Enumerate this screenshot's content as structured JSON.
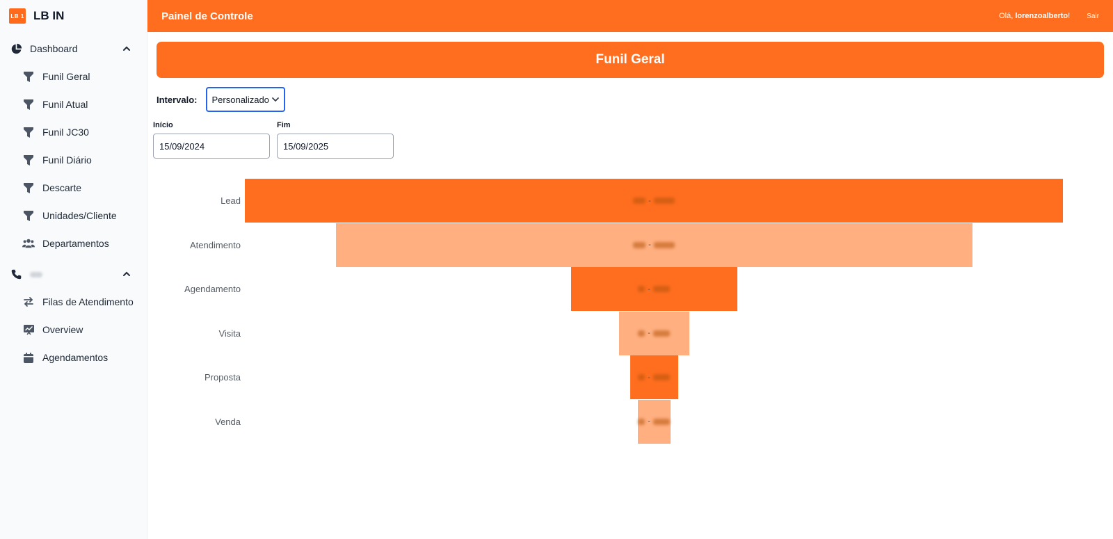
{
  "brand": {
    "logo_text": "LB 1",
    "name": "LB IN"
  },
  "sidebar": {
    "dashboard_section": {
      "label": "Dashboard",
      "icon": "pie-chart-icon",
      "expanded": true
    },
    "dashboard_items": [
      {
        "label": "Funil Geral",
        "icon": "funnel-icon"
      },
      {
        "label": "Funil Atual",
        "icon": "funnel-icon"
      },
      {
        "label": "Funil JC30",
        "icon": "funnel-icon"
      },
      {
        "label": "Funil Diário",
        "icon": "funnel-icon"
      },
      {
        "label": "Descarte",
        "icon": "funnel-icon"
      },
      {
        "label": "Unidades/Cliente",
        "icon": "funnel-icon"
      },
      {
        "label": "Departamentos",
        "icon": "users-icon"
      }
    ],
    "phone_section": {
      "icon": "phone-icon",
      "expanded": true
    },
    "phone_items": [
      {
        "label": "Filas de Atendimento",
        "icon": "transfer-arrows-icon"
      },
      {
        "label": "Overview",
        "icon": "chart-board-icon"
      },
      {
        "label": "Agendamentos",
        "icon": "calendar-icon"
      }
    ]
  },
  "topbar": {
    "title": "Painel de Controle",
    "greeting_prefix": "Olá, ",
    "username": "lorenzoalberto",
    "greeting_suffix": "!",
    "logout_label": "Sair"
  },
  "main": {
    "banner_title": "Funil Geral",
    "interval_label": "Intervalo:",
    "interval_value": "Personalizado",
    "start_label": "Início",
    "start_value": "15/09/2024",
    "end_label": "Fim",
    "end_value": "15/09/2025"
  },
  "colors": {
    "accent": "#ff6e1f",
    "bar_dark": "#ff6e1f",
    "bar_light": "#ffaf80"
  },
  "chart_data": {
    "type": "funnel",
    "categories": [
      "Lead",
      "Atendimento",
      "Agendamento",
      "Visita",
      "Proposta",
      "Venda"
    ],
    "relative_widths": [
      1.0,
      0.778,
      0.203,
      0.086,
      0.059,
      0.04
    ],
    "values_hidden": true,
    "colors": [
      "#ff6e1f",
      "#ffaf80",
      "#ff6e1f",
      "#ffaf80",
      "#ff6e1f",
      "#ffaf80"
    ]
  }
}
